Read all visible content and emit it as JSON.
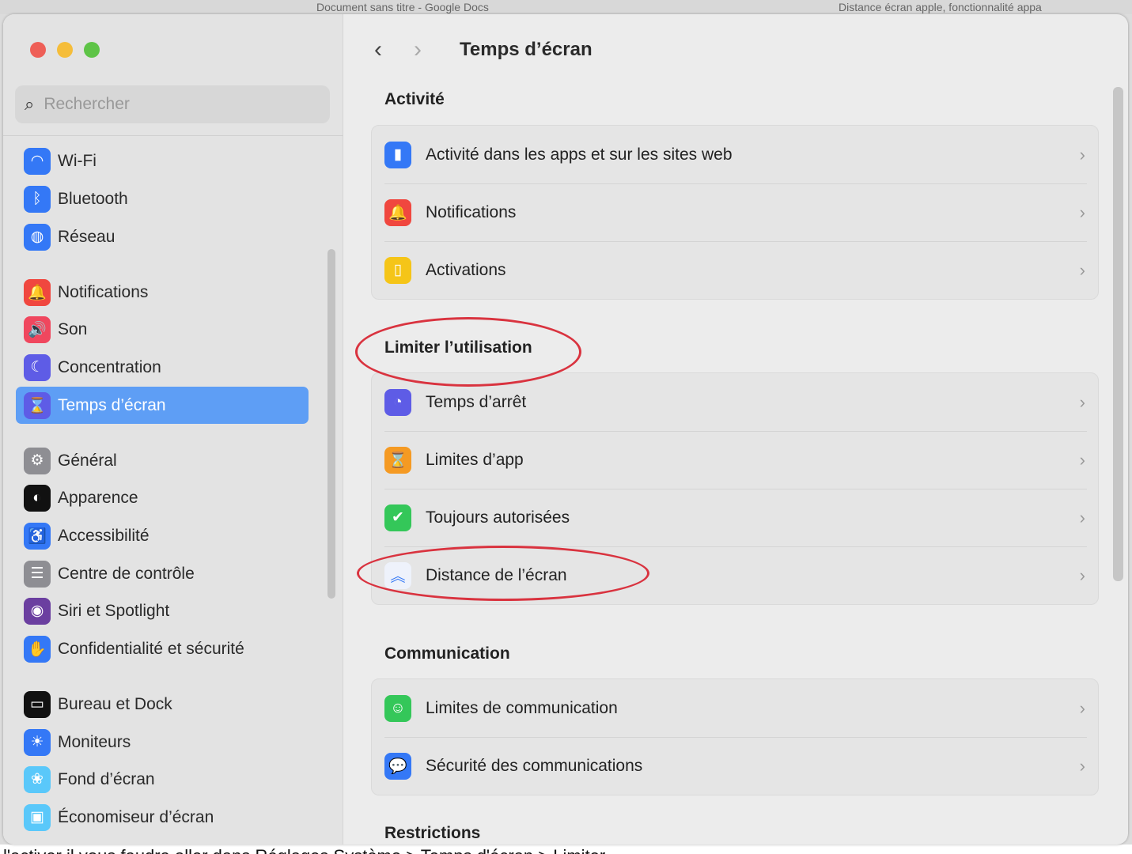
{
  "background": {
    "tab1": "Document sans titre - Google Docs",
    "tab2": "Distance écran apple, fonctionnalité appa",
    "doc_text": "l'activer il vous faudra aller dans Réglages Système > Temps d'écran > Limiter"
  },
  "sidebar": {
    "search_placeholder": "Rechercher",
    "items": [
      {
        "label": "Wi-Fi",
        "icon": "wifi-icon",
        "color": "#3478f6",
        "glyph": "◠"
      },
      {
        "label": "Bluetooth",
        "icon": "bluetooth-icon",
        "color": "#3478f6",
        "glyph": "ᛒ"
      },
      {
        "label": "Réseau",
        "icon": "globe-icon",
        "color": "#3478f6",
        "glyph": "◍"
      },
      {
        "label": "Notifications",
        "icon": "bell-icon",
        "color": "#f0473f",
        "glyph": "🔔"
      },
      {
        "label": "Son",
        "icon": "speaker-icon",
        "color": "#f0475e",
        "glyph": "🔊"
      },
      {
        "label": "Concentration",
        "icon": "moon-icon",
        "color": "#5e5ce6",
        "glyph": "☾"
      },
      {
        "label": "Temps d’écran",
        "icon": "hourglass-icon",
        "color": "#5e5ce6",
        "glyph": "⌛",
        "selected": true
      },
      {
        "label": "Général",
        "icon": "gear-icon",
        "color": "#8e8e93",
        "glyph": "⚙"
      },
      {
        "label": "Apparence",
        "icon": "appearance-icon",
        "color": "#111111",
        "glyph": "◐"
      },
      {
        "label": "Accessibilité",
        "icon": "accessibility-icon",
        "color": "#3478f6",
        "glyph": "♿"
      },
      {
        "label": "Centre de contrôle",
        "icon": "toggles-icon",
        "color": "#8e8e93",
        "glyph": "☰"
      },
      {
        "label": "Siri et Spotlight",
        "icon": "siri-icon",
        "color": "#6b3fa0",
        "glyph": "◉"
      },
      {
        "label": "Confidentialité et sécurité",
        "icon": "hand-icon",
        "color": "#3478f6",
        "glyph": "✋"
      },
      {
        "label": "Bureau et Dock",
        "icon": "dock-icon",
        "color": "#111111",
        "glyph": "▭"
      },
      {
        "label": "Moniteurs",
        "icon": "brightness-icon",
        "color": "#3478f6",
        "glyph": "☀"
      },
      {
        "label": "Fond d’écran",
        "icon": "flower-icon",
        "color": "#5ac8fa",
        "glyph": "❀"
      },
      {
        "label": "Économiseur d’écran",
        "icon": "screensaver-icon",
        "color": "#5ac8fa",
        "glyph": "▣"
      }
    ]
  },
  "header": {
    "title": "Temps d’écran",
    "back": "‹",
    "forward": "›"
  },
  "sections": [
    {
      "title": "Activité",
      "rows": [
        {
          "label": "Activité dans les apps et sur les sites web",
          "icon": "chart-bars-icon",
          "color": "#3478f6",
          "glyph": "▮"
        },
        {
          "label": "Notifications",
          "icon": "bell-icon",
          "color": "#f0473f",
          "glyph": "🔔"
        },
        {
          "label": "Activations",
          "icon": "pickup-icon",
          "color": "#f5c518",
          "glyph": "▯"
        }
      ]
    },
    {
      "title": "Limiter l’utilisation",
      "rows": [
        {
          "label": "Temps d’arrêt",
          "icon": "downtime-icon",
          "color": "#5e5ce6",
          "glyph": "◔"
        },
        {
          "label": "Limites d’app",
          "icon": "hourglass-icon",
          "color": "#f59a23",
          "glyph": "⌛"
        },
        {
          "label": "Toujours autorisées",
          "icon": "checkmark-icon",
          "color": "#34c759",
          "glyph": "✔"
        },
        {
          "label": "Distance de l’écran",
          "icon": "chevrons-up-icon",
          "color": "#eef2fb",
          "glyph": "︽"
        }
      ]
    },
    {
      "title": "Communication",
      "rows": [
        {
          "label": "Limites de communication",
          "icon": "person-circle-icon",
          "color": "#34c759",
          "glyph": "☺"
        },
        {
          "label": "Sécurité des communications",
          "icon": "message-shield-icon",
          "color": "#3478f6",
          "glyph": "💬"
        }
      ]
    },
    {
      "title": "Restrictions",
      "rows": []
    }
  ],
  "annotation_color": "#d9333f"
}
